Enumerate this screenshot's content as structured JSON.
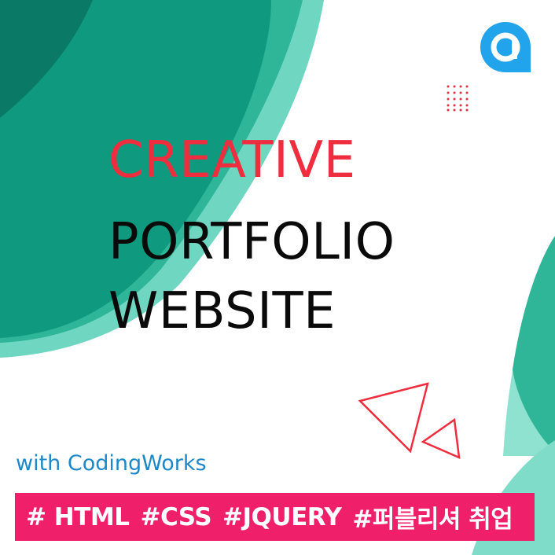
{
  "headline": {
    "line1": "CREATIVE",
    "line2": "PORTFOLIO",
    "line3": "WEBSITE"
  },
  "subtitle": "with CodingWorks",
  "tags": [
    "# HTML",
    "#CSS",
    "#JQUERY",
    "#퍼블리셔 취업"
  ],
  "logo": {
    "icon": "letter-a-logo-icon",
    "letter": "a"
  },
  "colors": {
    "accent_red": "#ee2d3e",
    "teal_dark": "#0f9a80",
    "teal_light": "#6fd9c3",
    "subtitle_blue": "#1d88c9",
    "tag_bar": "#ef1f6a",
    "logo_blue": "#22a4ec"
  }
}
